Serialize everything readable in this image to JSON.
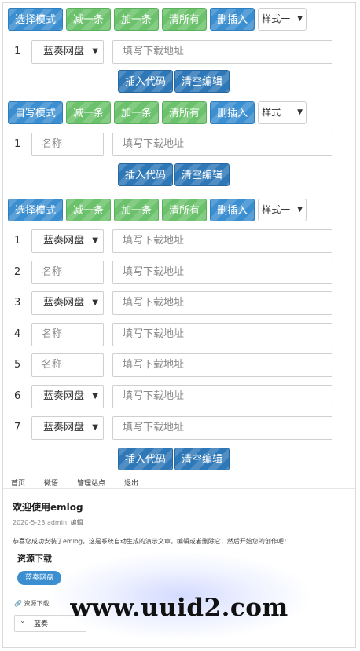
{
  "toolbar": {
    "select_mode": "选择模式",
    "write_mode": "自写模式",
    "minus": "减一条",
    "plus": "加一条",
    "clear_all": "清所有",
    "delete_insert": "删插入",
    "style": "样式一"
  },
  "form": {
    "disk": "蓝奏网盘",
    "name_placeholder": "名称",
    "url_placeholder": "填写下载地址",
    "insert_code": "插入代码",
    "clear_edit": "清空编辑"
  },
  "row_numbers": [
    "1",
    "2",
    "3",
    "4",
    "5",
    "6",
    "7"
  ],
  "nav": [
    "首页",
    "微语",
    "管理站点",
    "退出"
  ],
  "post": {
    "title": "欢迎使用emlog",
    "date": "2020-5-23",
    "author": "admin",
    "edit": "编辑",
    "body": "恭喜您成功安装了emlog，这是系统自动生成的演示文章。编辑或者删除它，然后开始您的创作吧！"
  },
  "resource": {
    "title": "资源下载",
    "tab": "蓝奏网盘",
    "link": "资源下载",
    "row": "蓝奏"
  },
  "watermark": "www.uuid2.com",
  "colors": {
    "blue": "#3b8fd1",
    "green": "#6cc26c",
    "dark_blue": "#2f78b8"
  },
  "icons": [
    "caret-down-icon",
    "paperclip-icon",
    "chevron-down-icon"
  ]
}
